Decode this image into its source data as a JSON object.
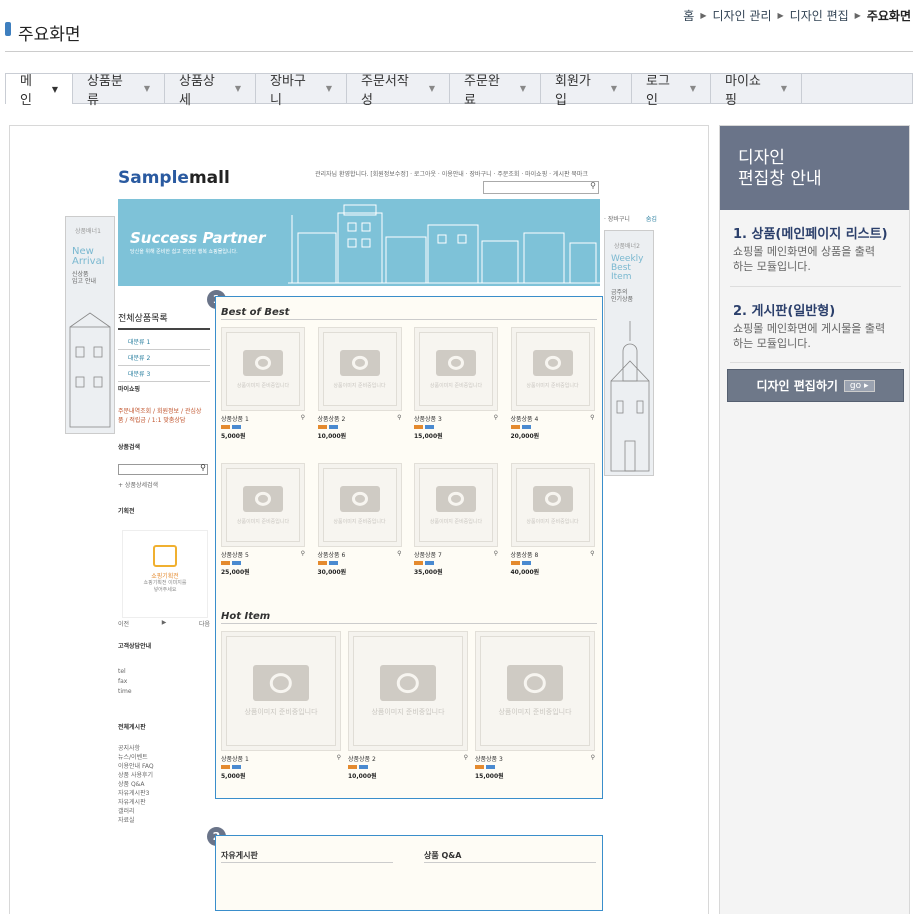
{
  "page": {
    "title": "주요화면"
  },
  "breadcrumb": [
    "홈",
    "디자인 관리",
    "디자인 편집",
    "주요화면"
  ],
  "tabs": [
    {
      "label": "메인"
    },
    {
      "label": "상품분류"
    },
    {
      "label": "상품상세"
    },
    {
      "label": "장바구니"
    },
    {
      "label": "주문서작성"
    },
    {
      "label": "주문완료"
    },
    {
      "label": "회원가입"
    },
    {
      "label": "로그인"
    },
    {
      "label": "마이쇼핑"
    }
  ],
  "panel": {
    "title_line1": "디자인",
    "title_line2": "편집창 안내",
    "items": [
      {
        "heading": "1. 상품(메인페이지 리스트)",
        "desc1": "쇼핑몰 메인화면에 상품을 출력",
        "desc2": "하는 모듈입니다."
      },
      {
        "heading": "2. 게시판(일반형)",
        "desc1": "쇼핑몰 메인화면에 게시물을 출력",
        "desc2": "하는 모듈입니다."
      }
    ],
    "edit_button": "디자인 편집하기",
    "go_label": "go"
  },
  "preview": {
    "logo_a": "Sample",
    "logo_b": "mall",
    "top_nav": "관리자님 환영합니다. [회원정보수정]  · 로그아웃 · 이용안내 · 장바구니 · 주문조회 · 마이쇼핑 · 게시판   북마크",
    "banner_title": "Success Partner",
    "banner_sub": "당신을 위해 준비한 쉽고 편안한 행복 쇼핑몰입니다.",
    "left_side": {
      "label": "상품배너1",
      "line1": "New",
      "line2": "Arrival",
      "desc1": "신상품",
      "desc2": "입고 안내"
    },
    "right_side": {
      "link1": "· 장바구니",
      "link2": "숨김",
      "label": "상품배너2",
      "line1": "Weekly",
      "line2": "Best",
      "line3": "Item",
      "desc1": "금주의",
      "desc2": "인기상품"
    },
    "category_title": "전체상품목록",
    "categories": [
      "대분류 1",
      "대분류 2",
      "대분류 3"
    ],
    "myshop_title": "마이쇼핑",
    "myshop_links1": "주문내역조회 / 회원정보 / 관심상",
    "myshop_links2": "품 / 적립금 / 1:1 맞춤상담",
    "search_title": "상품검색",
    "search_detail": "+ 상품상세검색",
    "plan_title": "기획전",
    "plan_name": "쇼핑기획전",
    "plan_desc1": "쇼핑기획전 이미지를",
    "plan_desc2": "넣어주세요",
    "plan_prev": "이전",
    "plan_next": "다음",
    "cs_title": "고객상담안내",
    "cs_lines": [
      "tel",
      "fax",
      "time"
    ],
    "board_title": "전체게시판",
    "boards": [
      "공지사항",
      "뉴스/이벤트",
      "이용안내 FAQ",
      "상품 사용후기",
      "상품 Q&A",
      "자유게시판3",
      "자유게시판",
      "갤러리",
      "자료실"
    ],
    "module1_num": "1",
    "best_title": "Best of Best",
    "placeholder_text": "상품이미지 준비중입니다",
    "best_items": [
      {
        "name": "상품상품 1",
        "price": "5,000원"
      },
      {
        "name": "상품상품 2",
        "price": "10,000원"
      },
      {
        "name": "상품상품 3",
        "price": "15,000원"
      },
      {
        "name": "상품상품 4",
        "price": "20,000원"
      },
      {
        "name": "상품상품 5",
        "price": "25,000원"
      },
      {
        "name": "상품상품 6",
        "price": "30,000원"
      },
      {
        "name": "상품상품 7",
        "price": "35,000원"
      },
      {
        "name": "상품상품 8",
        "price": "40,000원"
      }
    ],
    "hot_title": "Hot Item",
    "hot_items": [
      {
        "name": "상품상품 1",
        "price": "5,000원"
      },
      {
        "name": "상품상품 2",
        "price": "10,000원"
      },
      {
        "name": "상품상품 3",
        "price": "15,000원"
      }
    ],
    "module2_num": "2",
    "board_left": "자유게시판",
    "board_right": "상품 Q&A"
  }
}
